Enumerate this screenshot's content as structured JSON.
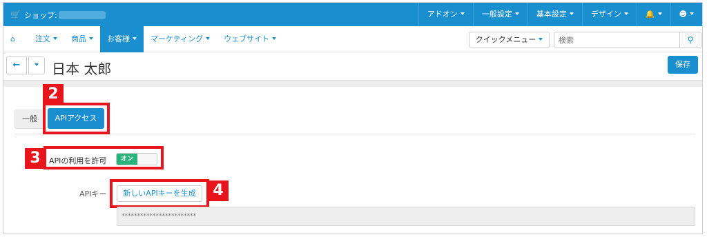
{
  "topbar": {
    "shop_label": "ショップ:",
    "menu": [
      "アドオン",
      "一般設定",
      "基本設定",
      "デザイン"
    ],
    "bell_icon": "bell-icon",
    "user_icon": "user-icon",
    "color": "#1a8fcf"
  },
  "nav": {
    "items": [
      "注文",
      "商品",
      "お客様",
      "マーケティング",
      "ウェブサイト"
    ],
    "active_index": 2,
    "quick_menu": "クイックメニュー",
    "search_placeholder": "検索"
  },
  "header": {
    "title": "日本 太郎",
    "save_label": "保存"
  },
  "tabs": [
    "一般",
    "APIアクセス"
  ],
  "api": {
    "allow_label": "APIの利用を許可",
    "toggle_state": "オン",
    "key_label": "APIキー",
    "generate_label": "新しいAPIキーを生成",
    "key_value": "************************"
  },
  "annotations": [
    "2",
    "3",
    "4"
  ],
  "colors": {
    "accent": "#1a8fcf",
    "toggle_on": "#2ab27b",
    "annotation": "#e8141c"
  }
}
